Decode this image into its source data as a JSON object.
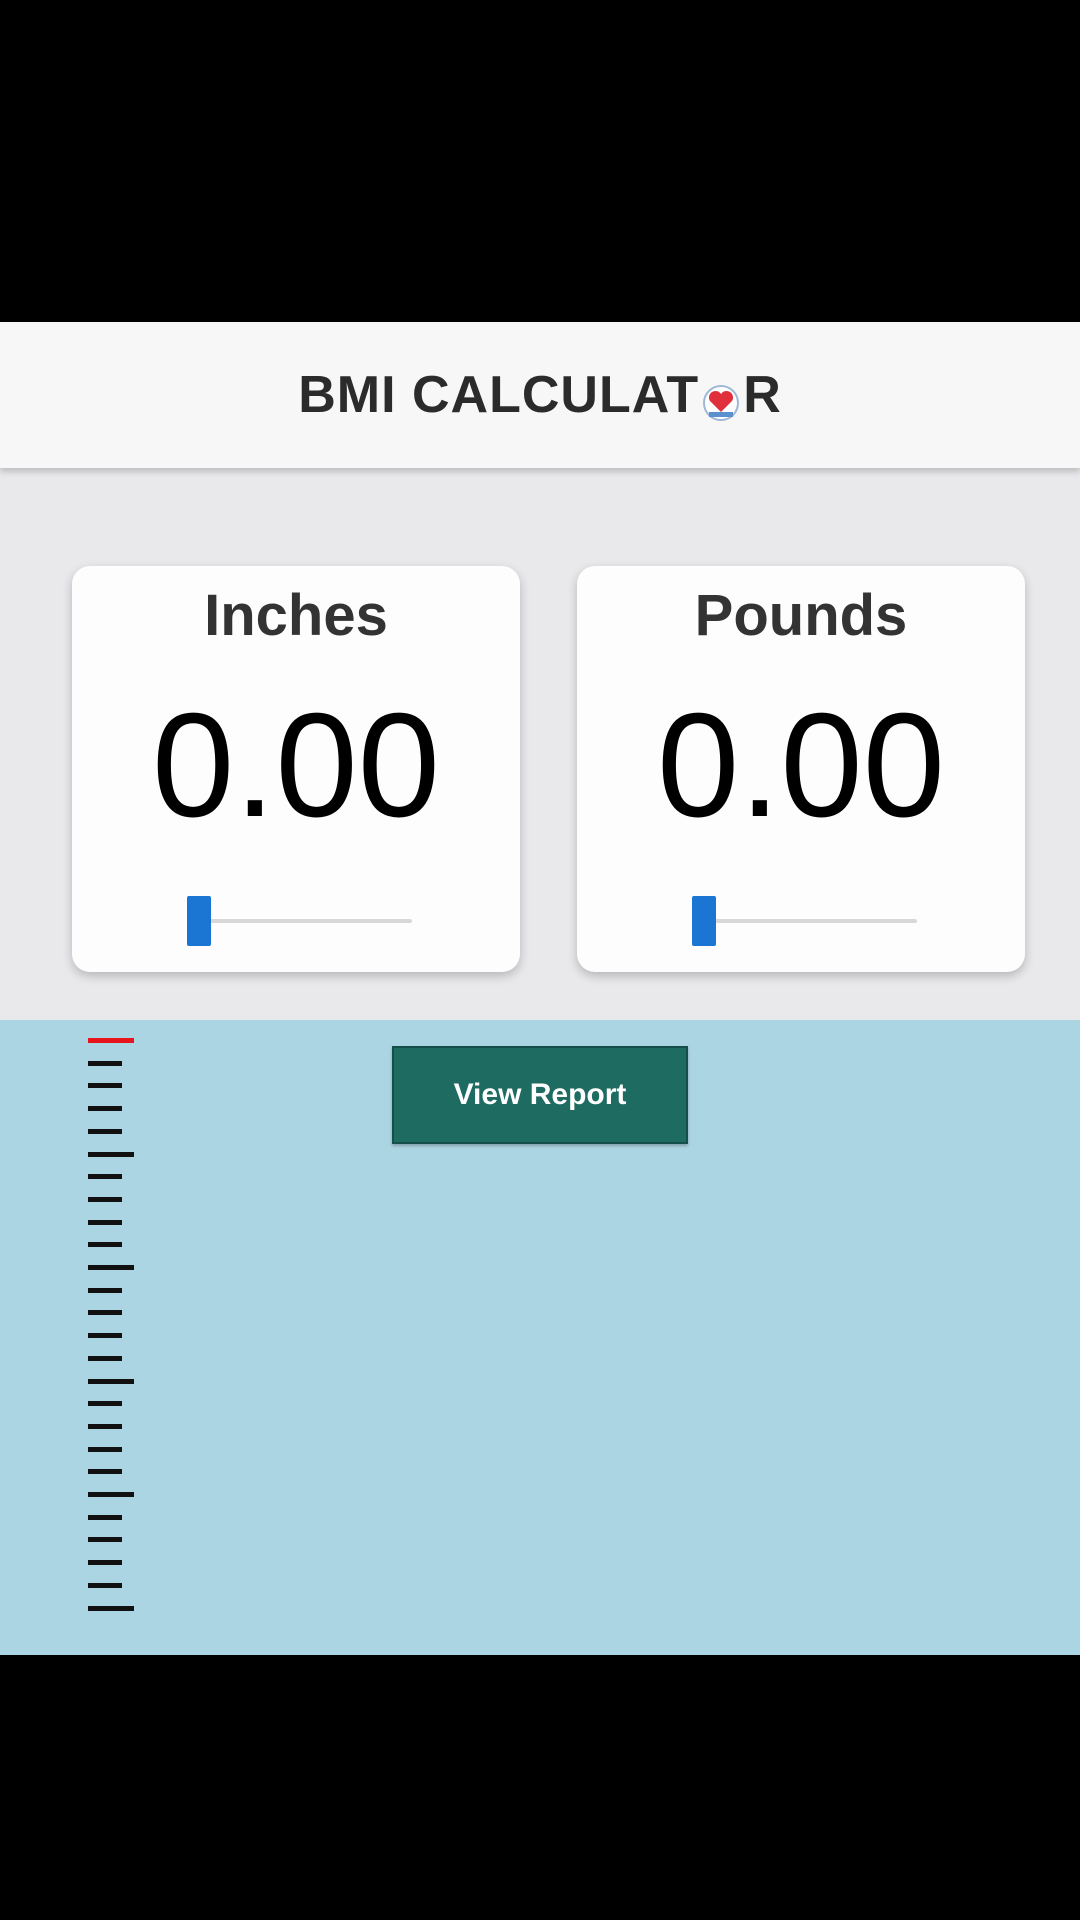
{
  "header": {
    "title_before": "BMI CALCULAT",
    "title_after": "R",
    "logo_icon": "heart-scale-icon"
  },
  "cards": {
    "height": {
      "label": "Inches",
      "value": "0.00",
      "slider_fraction": 0
    },
    "weight": {
      "label": "Pounds",
      "value": "0.00",
      "slider_fraction": 0
    }
  },
  "actions": {
    "view_report_label": "View Report"
  },
  "colors": {
    "accent": "#1a76d2",
    "button": "#1e6b62",
    "lower_background": "#acd5e3",
    "ruler_marker": "#e8141c"
  }
}
